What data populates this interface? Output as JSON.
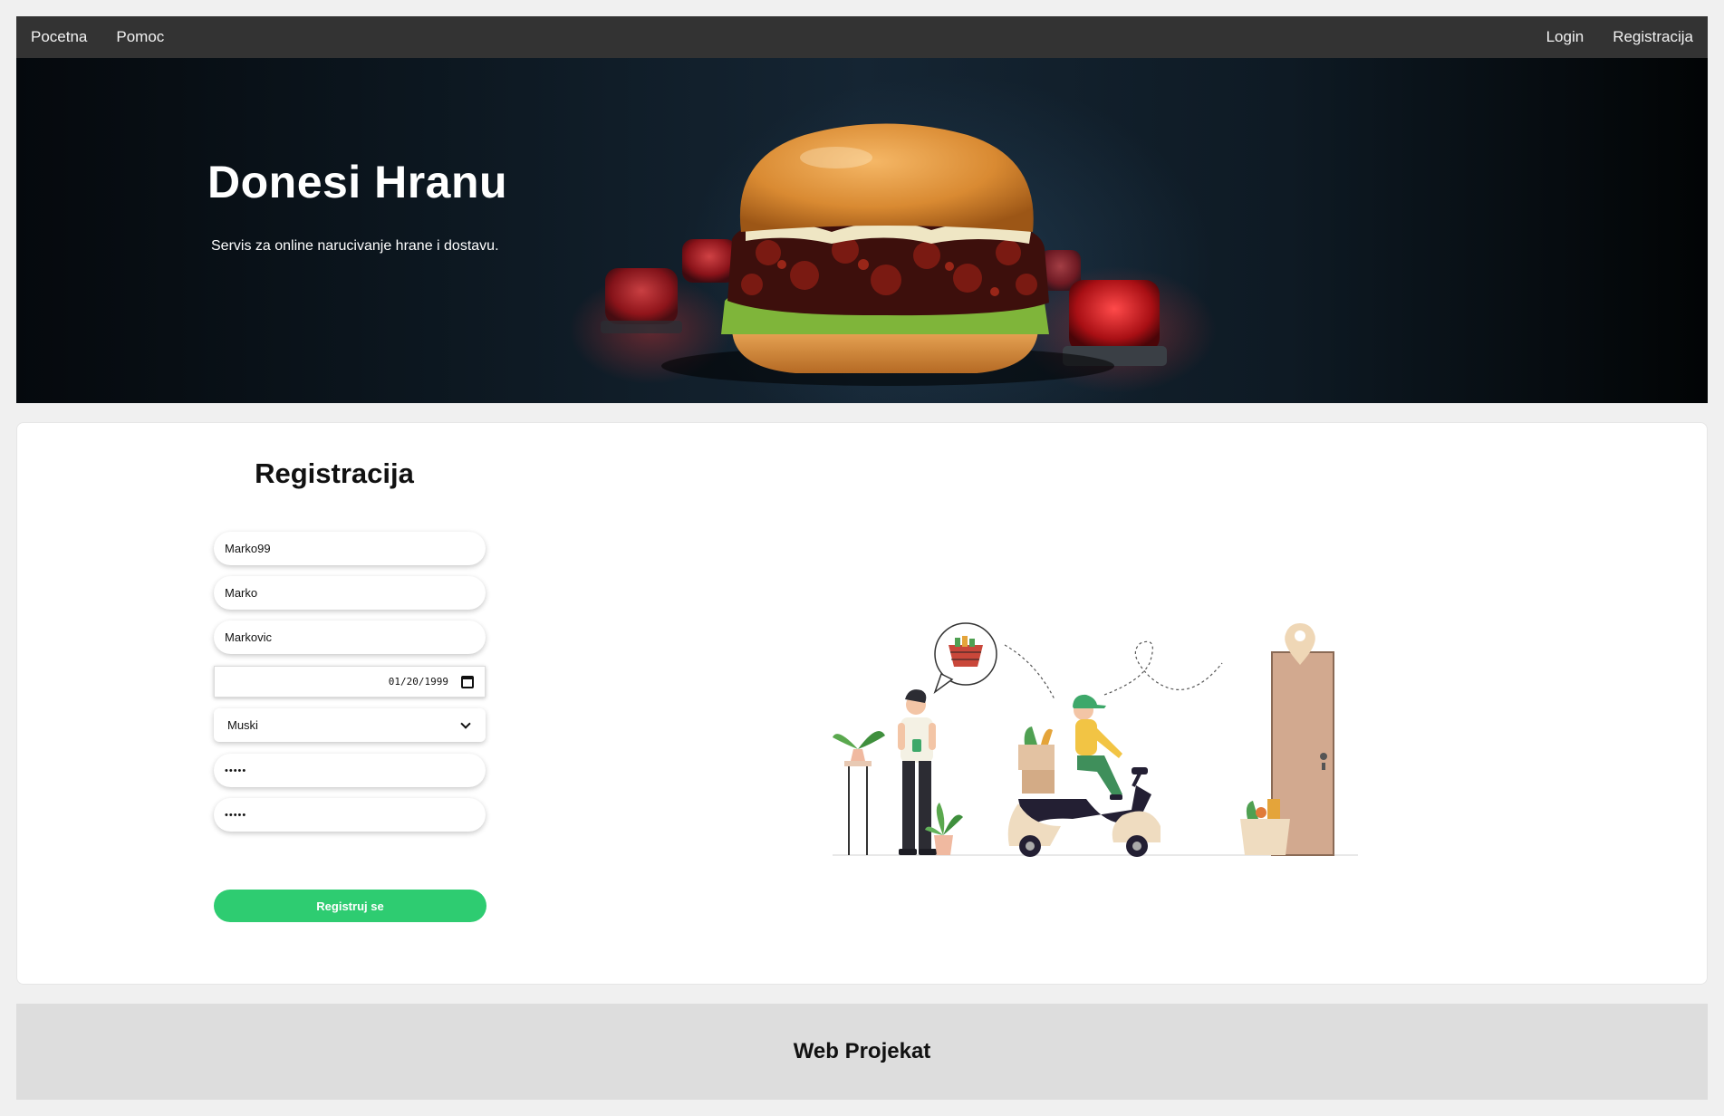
{
  "nav": {
    "left": [
      "Pocetna",
      "Pomoc"
    ],
    "right": [
      "Login",
      "Registracija"
    ]
  },
  "hero": {
    "title": "Donesi Hranu",
    "subtitle": "Servis za online narucivanje hrane i dostavu."
  },
  "form": {
    "title": "Registracija",
    "username": "Marko99",
    "first_name": "Marko",
    "last_name": "Markovic",
    "birth_date": "01/20/1999",
    "gender": "Muski",
    "password": "•••••",
    "password_confirm": "•••••",
    "submit_label": "Registruj se"
  },
  "footer": {
    "text": "Web Projekat"
  },
  "colors": {
    "nav_bg": "#333333",
    "submit_bg": "#2ecc71",
    "footer_bg": "#dddddd"
  }
}
